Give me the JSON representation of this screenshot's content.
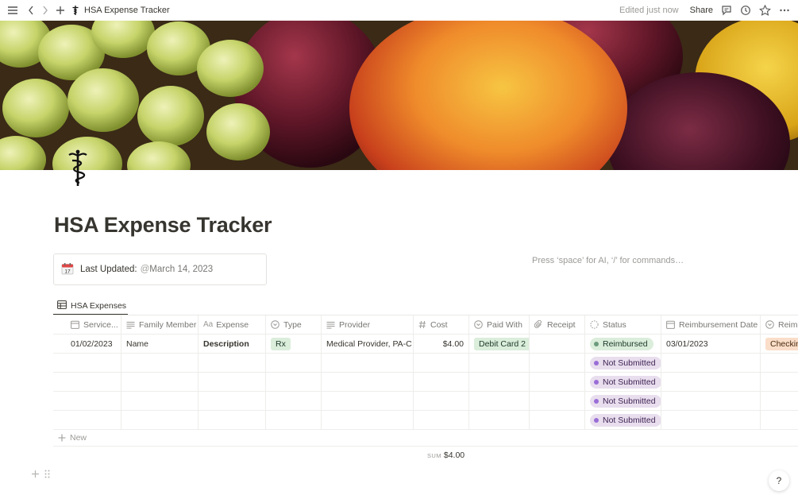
{
  "topbar": {
    "breadcrumb": "HSA Expense Tracker",
    "edited": "Edited just now",
    "share": "Share"
  },
  "page": {
    "title": "HSA Expense Tracker",
    "icon": "caduceus-icon",
    "callout": {
      "icon": "calendar-icon",
      "label": "Last Updated:",
      "at": "@",
      "date": "March 14, 2023"
    },
    "ai_hint": "Press ‘space’ for AI, ‘/’ for commands…"
  },
  "view": {
    "tab_label": "HSA Expenses"
  },
  "table": {
    "columns": [
      {
        "label": "Service...",
        "icon": "calendar-icon"
      },
      {
        "label": "Family Member",
        "icon": "text-icon"
      },
      {
        "label": "Expense",
        "icon": "title-icon",
        "icon_text": "Aa"
      },
      {
        "label": "Type",
        "icon": "select-icon"
      },
      {
        "label": "Provider",
        "icon": "text-icon"
      },
      {
        "label": "Cost",
        "icon": "number-icon"
      },
      {
        "label": "Paid With",
        "icon": "select-icon"
      },
      {
        "label": "Receipt",
        "icon": "paperclip-icon"
      },
      {
        "label": "Status",
        "icon": "status-icon"
      },
      {
        "label": "Reimbursement Date",
        "icon": "calendar-icon"
      },
      {
        "label": "Reimb",
        "icon": "select-icon"
      }
    ],
    "rows": [
      {
        "service_date": "01/02/2023",
        "family_member": "Name",
        "expense": "Description",
        "type": "Rx",
        "provider": "Medical Provider, PA-C",
        "cost": "$4.00",
        "paid_with": "Debit Card 2",
        "receipt": "",
        "status": "Reimbursed",
        "reimbursement_date": "03/01/2023",
        "reimb": "Checkin"
      },
      {
        "status": "Not Submitted"
      },
      {
        "status": "Not Submitted"
      },
      {
        "status": "Not Submitted"
      },
      {
        "status": "Not Submitted"
      }
    ],
    "new_label": "New",
    "sum_label": "SUM",
    "sum_value": "$4.00"
  },
  "colors": {
    "text": "#37352f",
    "muted": "#9b9a97",
    "tag_green_bg": "#dbeddb",
    "tag_orange_bg": "#fadec9",
    "status_purple_bg": "#e8deee"
  },
  "help": "?"
}
